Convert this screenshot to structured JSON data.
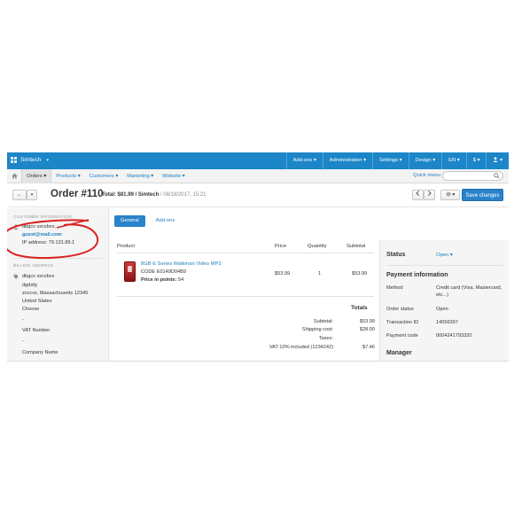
{
  "topbar": {
    "brand": "Simtech",
    "menu": [
      "Add-ons",
      "Administration",
      "Settings",
      "Design",
      "EN",
      "$",
      ""
    ]
  },
  "subnav": {
    "items": [
      "Orders",
      "Products",
      "Customers",
      "Marketing",
      "Website"
    ],
    "quick_menu": "Quick menu",
    "search_placeholder": ""
  },
  "titlebar": {
    "back_label": "←",
    "order_title": "Order #110",
    "total_label": "Total: $81.99 / Simtech",
    "date": " / 06/19/2017, 15:21",
    "save_label": "Save changes"
  },
  "sidebar": {
    "customer_head": "CUSTOMER INFORMATION",
    "customer_name": "dbgcv xxcvbvx,",
    "customer_email": "guest@mail.com",
    "ip_address": "IP address: 79.131.89.1",
    "billing_head": "BILLING ADDRESS",
    "billing_name": "dbgcv xxcvbvx",
    "billing_line1": "dgdsfg",
    "billing_line2": "zxccxz, Massachusetts 12345",
    "billing_country": "United States",
    "billing_choose": "Choose",
    "billing_dash1": "-",
    "vat_label": "VAT Number",
    "vat_dash": "-",
    "company_label": "Company Name"
  },
  "tabs": [
    "General",
    "Add-ons"
  ],
  "product_table": {
    "headers": {
      "product": "Product",
      "price": "Price",
      "quantity": "Quantity",
      "subtotal": "Subtotal"
    },
    "row": {
      "name": "8GB E Series Walkman Video MP3",
      "code": "CODE E0149D04B9",
      "points_label": "Price in points:",
      "points_value": " 54",
      "price": "$53.99",
      "quantity": "1",
      "subtotal": "$53.99"
    }
  },
  "totals": {
    "heading": "Totals",
    "rows": [
      {
        "label": "Subtotal:",
        "value": "$53.99"
      },
      {
        "label": "Shipping cost:",
        "value": "$28.00"
      },
      {
        "label": "Taxes:",
        "value": ""
      },
      {
        "label": "VAT 10% included (1234242)",
        "value": "$7.46"
      }
    ]
  },
  "right_panel": {
    "status_head": "Status",
    "status_value": "Open ▾",
    "payment_head": "Payment information",
    "method_label": "Method",
    "method_value": "Credit card (Visa, Mastercard, etc...)",
    "order_status_label": "Order status",
    "order_status_value": "Open",
    "transaction_label": "Transaction ID",
    "transaction_value": "14556397",
    "payment_code_label": "Payment code",
    "payment_code_value": "0004241793320",
    "manager_head": "Manager"
  },
  "colors": {
    "topbar": "#1c86c8",
    "primary_button": "#2a82c9",
    "link": "#1f7ec0",
    "annotation": "#d9231f"
  }
}
